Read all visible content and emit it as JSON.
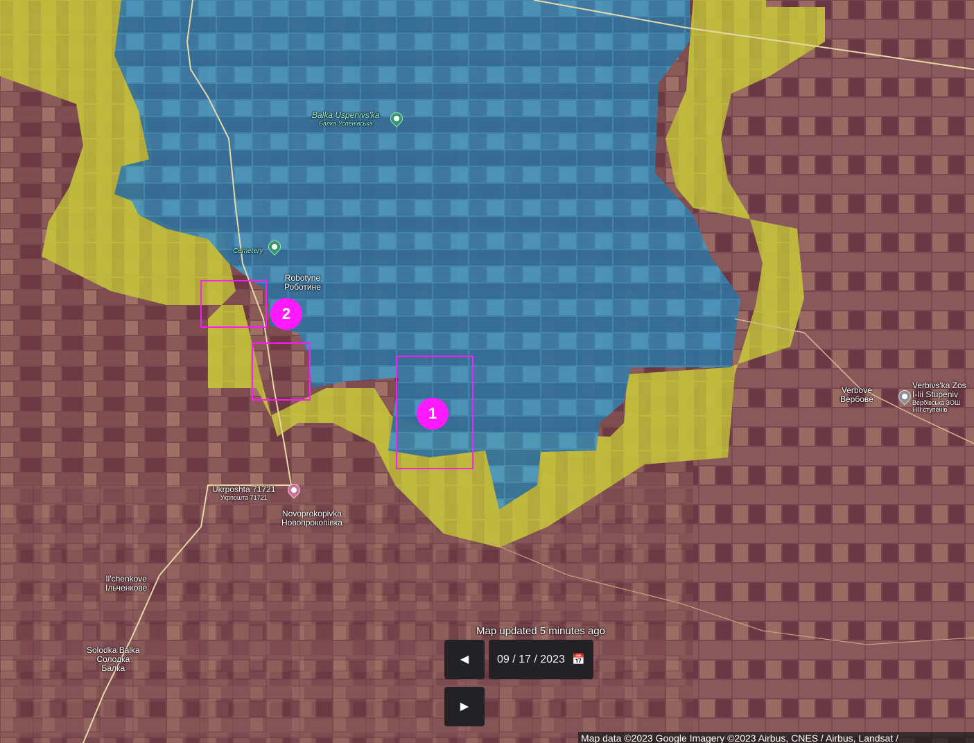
{
  "colors": {
    "terrain_base": "#7a4a4e",
    "ukraine_control": "#3b8fc0",
    "contested": "#c8c63a",
    "marker": "#ff1aff",
    "control_bg": "#222226"
  },
  "places": {
    "balka": {
      "latin": "Balka Uspenivs'ka",
      "cyrillic": "Балка Успенівська",
      "icon": "park-pin-icon"
    },
    "cemetery": {
      "latin": "Cemetery",
      "icon": "cemetery-pin-icon"
    },
    "robotyne": {
      "latin": "Robotyne",
      "cyrillic": "Роботине"
    },
    "ukrposhta": {
      "latin": "Ukrposhta 71721",
      "cyrillic": "Укрпошта 71721",
      "icon": "post-office-pin-icon"
    },
    "novoprokopivka": {
      "latin": "Novoprokopivka",
      "cyrillic": "Новопрокопівка"
    },
    "ilchenkove": {
      "latin": "Il'chenkove",
      "cyrillic": "Ільченкове"
    },
    "solodka": {
      "latin": "Solodka Balka",
      "cyrillic_1": "Солодка",
      "cyrillic_2": "Балка"
    },
    "verbove": {
      "latin": "Verbove",
      "cyrillic": "Вербове"
    },
    "school": {
      "latin_1": "Verbivs'ka Zos",
      "latin_2": "I-Iii Stupeniv",
      "cyrillic_1": "Вербівська ЗОШ",
      "cyrillic_2": "І-ІІІ ступенів",
      "icon": "school-pin-icon"
    }
  },
  "markers": [
    {
      "label": "1"
    },
    {
      "label": "2"
    }
  ],
  "controls": {
    "updated_text": "Map updated 5 minutes ago",
    "prev_icon": "play-left-icon",
    "prev_glyph": "◀",
    "next_icon": "play-right-icon",
    "next_glyph": "▶",
    "date_value": "09 / 17 / 2023",
    "calendar_icon": "calendar-icon"
  },
  "attribution": "Map data ©2023 Google Imagery ©2023 Airbus, CNES / Airbus, Landsat /"
}
